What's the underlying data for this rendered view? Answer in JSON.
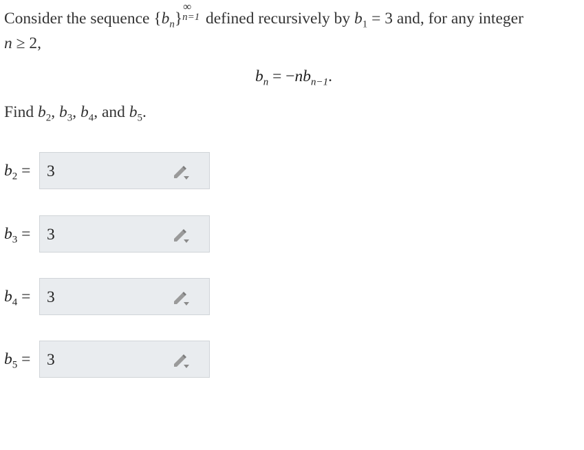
{
  "problem": {
    "p1": "Consider the sequence ",
    "seq_open": "{",
    "seq_var": "b",
    "seq_sub": "n",
    "seq_close": "}",
    "seq_sup": "∞",
    "seq_lower": "n=1",
    "p2": " defined recursively by ",
    "init_var": "b",
    "init_sub": "1",
    "init_eq": " = 3",
    "p3": " and, for any integer ",
    "cond_var": "n",
    "cond_rest": " ≥ 2,",
    "rec_lhs_var": "b",
    "rec_lhs_sub": "n",
    "rec_eq": " = −",
    "rec_n": "n",
    "rec_var": "b",
    "rec_sub": "n−1",
    "rec_dot": ".",
    "find_prefix": "Find ",
    "find_items": [
      {
        "var": "b",
        "sub": "2",
        "sep": ", "
      },
      {
        "var": "b",
        "sub": "3",
        "sep": ", "
      },
      {
        "var": "b",
        "sub": "4",
        "sep": ", and "
      },
      {
        "var": "b",
        "sub": "5",
        "sep": "."
      }
    ]
  },
  "answers": [
    {
      "var": "b",
      "sub": "2",
      "eq": " = ",
      "value": "3"
    },
    {
      "var": "b",
      "sub": "3",
      "eq": " = ",
      "value": "3"
    },
    {
      "var": "b",
      "sub": "4",
      "eq": " = ",
      "value": "3"
    },
    {
      "var": "b",
      "sub": "5",
      "eq": " = ",
      "value": "3"
    }
  ],
  "icons": {
    "edit": "pencil-dropdown-icon"
  },
  "colors": {
    "field_bg": "#e9ecef",
    "field_border": "#d0d4d8",
    "icon": "#8a8a8a"
  }
}
